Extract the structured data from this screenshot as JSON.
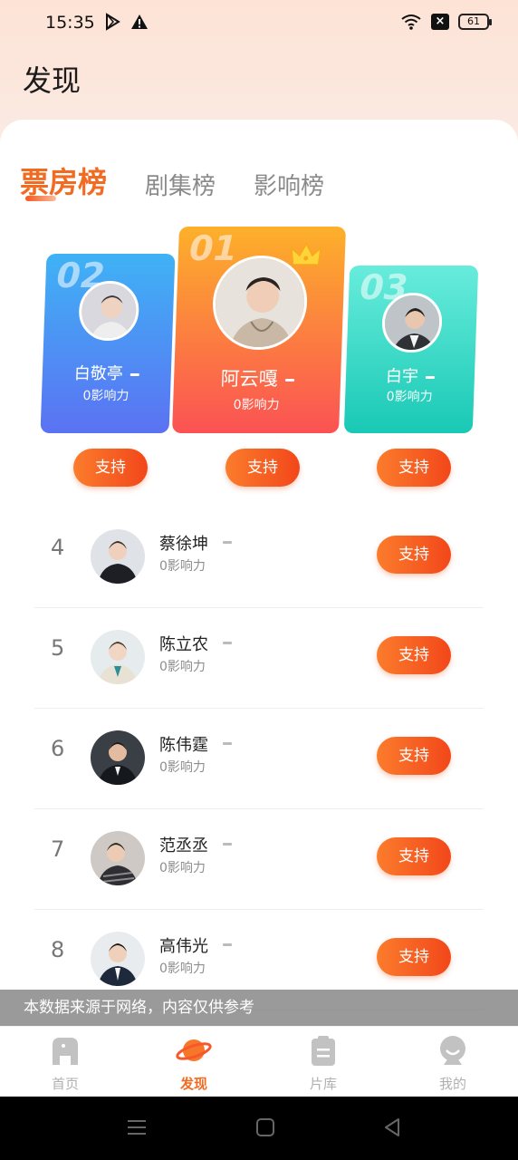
{
  "status_bar": {
    "time": "15:35",
    "battery": "61",
    "icons": [
      "play-store-icon",
      "warning-icon",
      "wifi-icon",
      "close-box-icon",
      "battery-icon"
    ]
  },
  "page_title": "发现",
  "tabs": [
    {
      "label": "票房榜",
      "active": true
    },
    {
      "label": "剧集榜",
      "active": false
    },
    {
      "label": "影响榜",
      "active": false
    }
  ],
  "podium": [
    {
      "rank": "02",
      "name": "白敬亭",
      "score": "0影响力",
      "trend": "–",
      "support": "支持",
      "color_top": "#3fb2f5",
      "color_bottom": "#5b72f3"
    },
    {
      "rank": "01",
      "name": "阿云嘎",
      "score": "0影响力",
      "trend": "–",
      "support": "支持",
      "color_top": "#fdb02a",
      "color_bottom": "#fb5254"
    },
    {
      "rank": "03",
      "name": "白宇",
      "score": "0影响力",
      "trend": "–",
      "support": "支持",
      "color_top": "#68ecdc",
      "color_bottom": "#19c9b5"
    }
  ],
  "list": [
    {
      "rank": "4",
      "name": "蔡徐坤",
      "score": "0影响力",
      "support": "支持"
    },
    {
      "rank": "5",
      "name": "陈立农",
      "score": "0影响力",
      "support": "支持"
    },
    {
      "rank": "6",
      "name": "陈伟霆",
      "score": "0影响力",
      "support": "支持"
    },
    {
      "rank": "7",
      "name": "范丞丞",
      "score": "0影响力",
      "support": "支持"
    },
    {
      "rank": "8",
      "name": "高伟光",
      "score": "0影响力",
      "support": "支持"
    }
  ],
  "disclaimer": "本数据来源于网络，内容仅供参考",
  "bottom_nav": [
    {
      "label": "首页",
      "icon": "home-icon",
      "active": false
    },
    {
      "label": "发现",
      "icon": "planet-icon",
      "active": true
    },
    {
      "label": "片库",
      "icon": "clipboard-icon",
      "active": false
    },
    {
      "label": "我的",
      "icon": "profile-icon",
      "active": false
    }
  ],
  "colors": {
    "accent": "#f26b22",
    "button": "#f2471a"
  }
}
